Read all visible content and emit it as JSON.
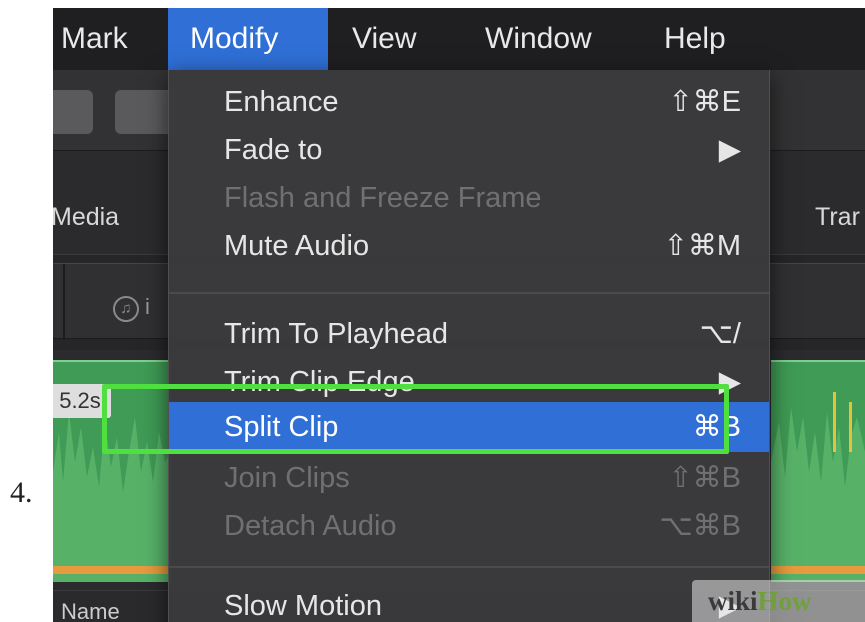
{
  "step_number": "4.",
  "menubar": {
    "items": [
      "Mark",
      "Modify",
      "View",
      "Window",
      "Help"
    ],
    "active": "Modify"
  },
  "panel": {
    "left_tab": "Media",
    "right_tab": "Trar",
    "browser_trail": "i",
    "clip_duration": "5.2s",
    "footer_name": "Name"
  },
  "menu": {
    "items": [
      {
        "label": "Enhance",
        "shortcut": "⇧⌘E",
        "enabled": true
      },
      {
        "label": "Fade to",
        "shortcut": "▶",
        "enabled": true
      },
      {
        "label": "Flash and Freeze Frame",
        "shortcut": "",
        "enabled": false
      },
      {
        "label": "Mute Audio",
        "shortcut": "⇧⌘M",
        "enabled": true
      },
      {
        "label": "Trim To Playhead",
        "shortcut": "⌥/",
        "enabled": true
      },
      {
        "label": "Trim Clip Edge",
        "shortcut": "▶",
        "enabled": true
      },
      {
        "label": "Split Clip",
        "shortcut": "⌘B",
        "enabled": true,
        "selected": true
      },
      {
        "label": "Join Clips",
        "shortcut": "⇧⌘B",
        "enabled": false
      },
      {
        "label": "Detach Audio",
        "shortcut": "⌥⌘B",
        "enabled": false
      },
      {
        "label": "Slow Motion",
        "shortcut": "▶",
        "enabled": true
      }
    ]
  },
  "watermark": {
    "part1": "wiki",
    "part2": "How"
  },
  "colors": {
    "menu_highlight": "#2f6fd6",
    "callout_border": "#4fe040",
    "clip_green": "#3f9b55",
    "clip_edge_orange": "#e79a3e"
  },
  "icons": [
    "music-note-icon",
    "submenu-arrow-icon"
  ]
}
